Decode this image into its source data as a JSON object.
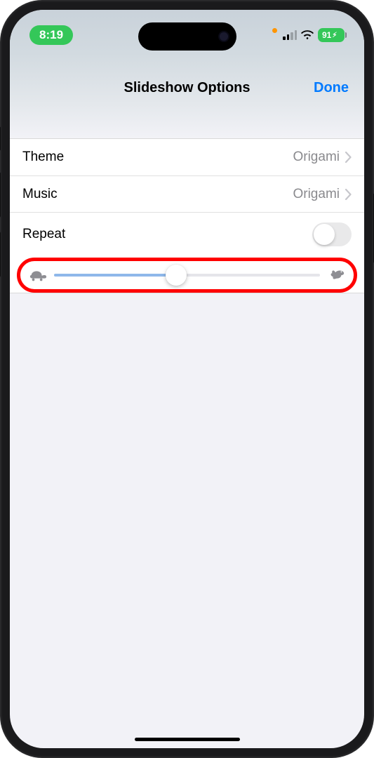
{
  "status": {
    "time": "8:19",
    "battery_text": "91"
  },
  "header": {
    "title": "Slideshow Options",
    "done_label": "Done"
  },
  "options": {
    "theme": {
      "label": "Theme",
      "value": "Origami"
    },
    "music": {
      "label": "Music",
      "value": "Origami"
    },
    "repeat": {
      "label": "Repeat",
      "on": false
    },
    "speed": {
      "percent": 46
    }
  }
}
